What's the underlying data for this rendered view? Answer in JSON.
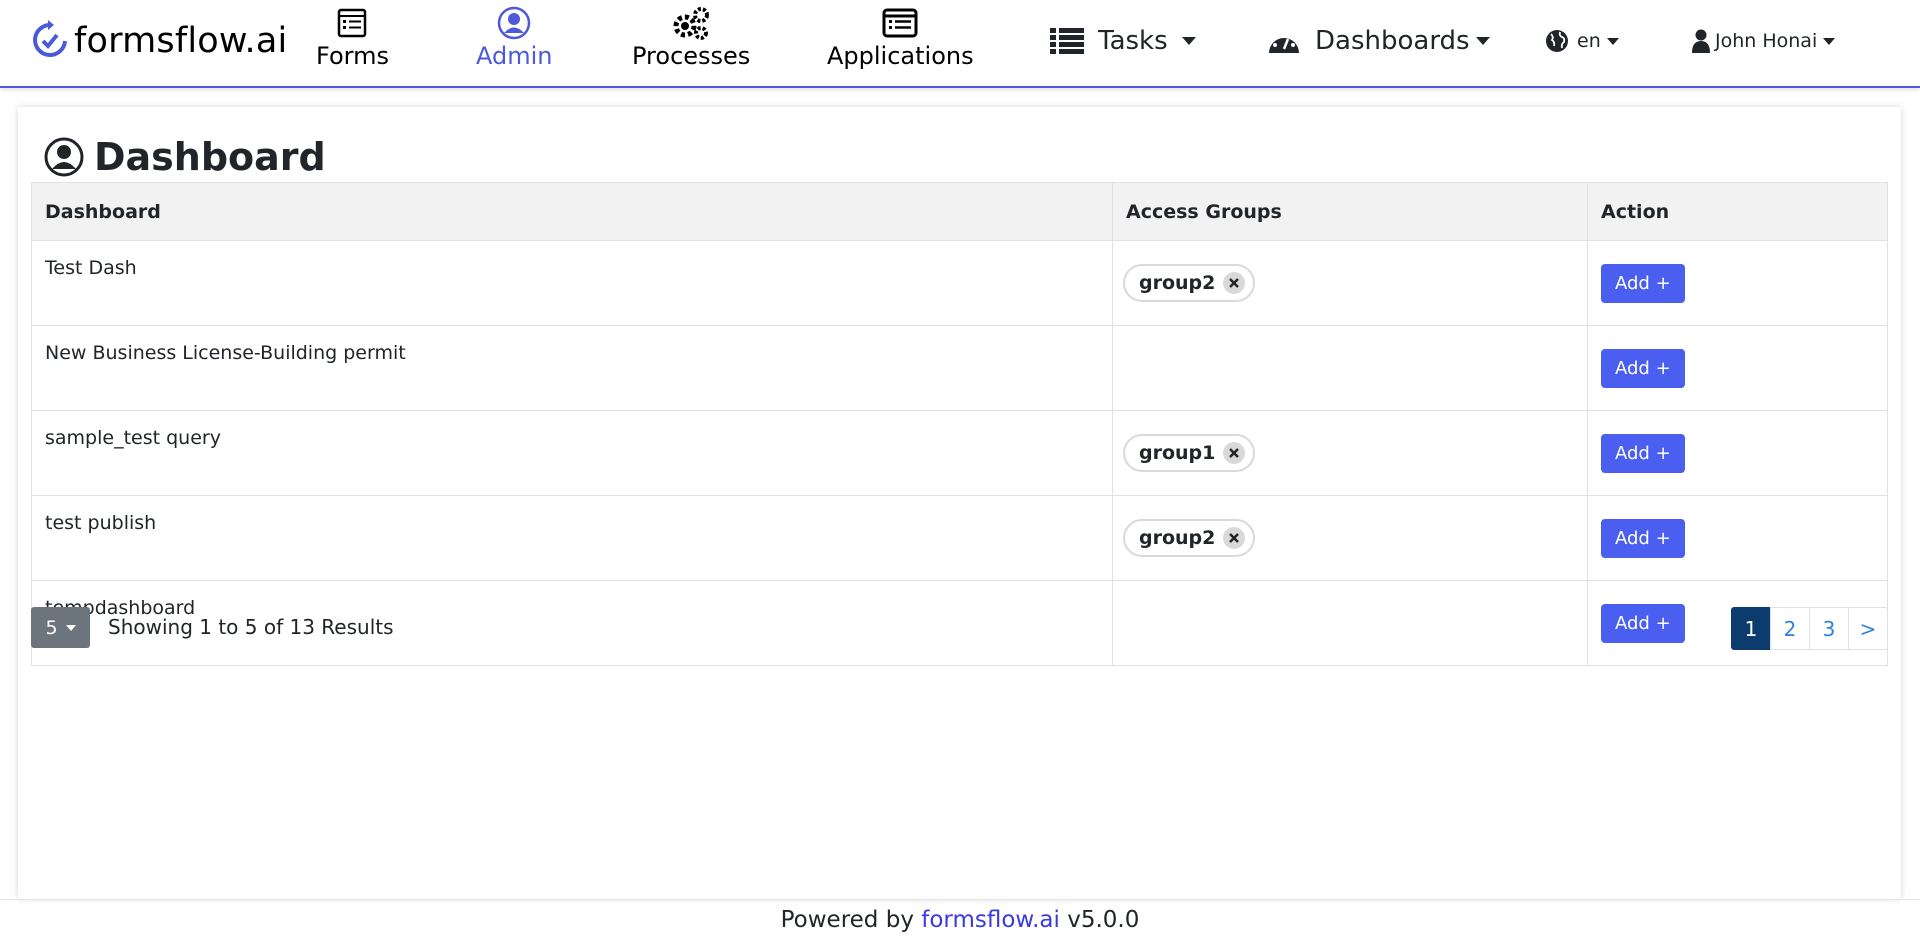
{
  "brand": {
    "name": "formsflow.ai"
  },
  "nav": {
    "forms": "Forms",
    "admin": "Admin",
    "processes": "Processes",
    "applications": "Applications",
    "tasks": "Tasks",
    "dashboards": "Dashboards",
    "language": "en",
    "user": "John Honai"
  },
  "colors": {
    "accent": "#4a5ad8",
    "button": "#4a5ef0",
    "active_page": "#0c3b6e"
  },
  "page": {
    "title": "Dashboard"
  },
  "table": {
    "headers": [
      "Dashboard",
      "Access Groups",
      "Action"
    ],
    "rows": [
      {
        "name": "Test Dash",
        "groups": [
          "group2"
        ],
        "action": "Add +"
      },
      {
        "name": "New Business License-Building permit",
        "groups": [],
        "action": "Add +"
      },
      {
        "name": "sample_test query",
        "groups": [
          "group1"
        ],
        "action": "Add +"
      },
      {
        "name": "test publish",
        "groups": [
          "group2"
        ],
        "action": "Add +"
      },
      {
        "name": "tempdashboard",
        "groups": [],
        "action": "Add +"
      }
    ]
  },
  "pagination": {
    "page_size": "5",
    "summary": "Showing 1 to 5 of 13 Results",
    "pages": [
      "1",
      "2",
      "3",
      ">"
    ],
    "active_page": "1"
  },
  "footer": {
    "prefix": "Powered by ",
    "link": "formsflow.ai",
    "version": " v5.0.0"
  }
}
